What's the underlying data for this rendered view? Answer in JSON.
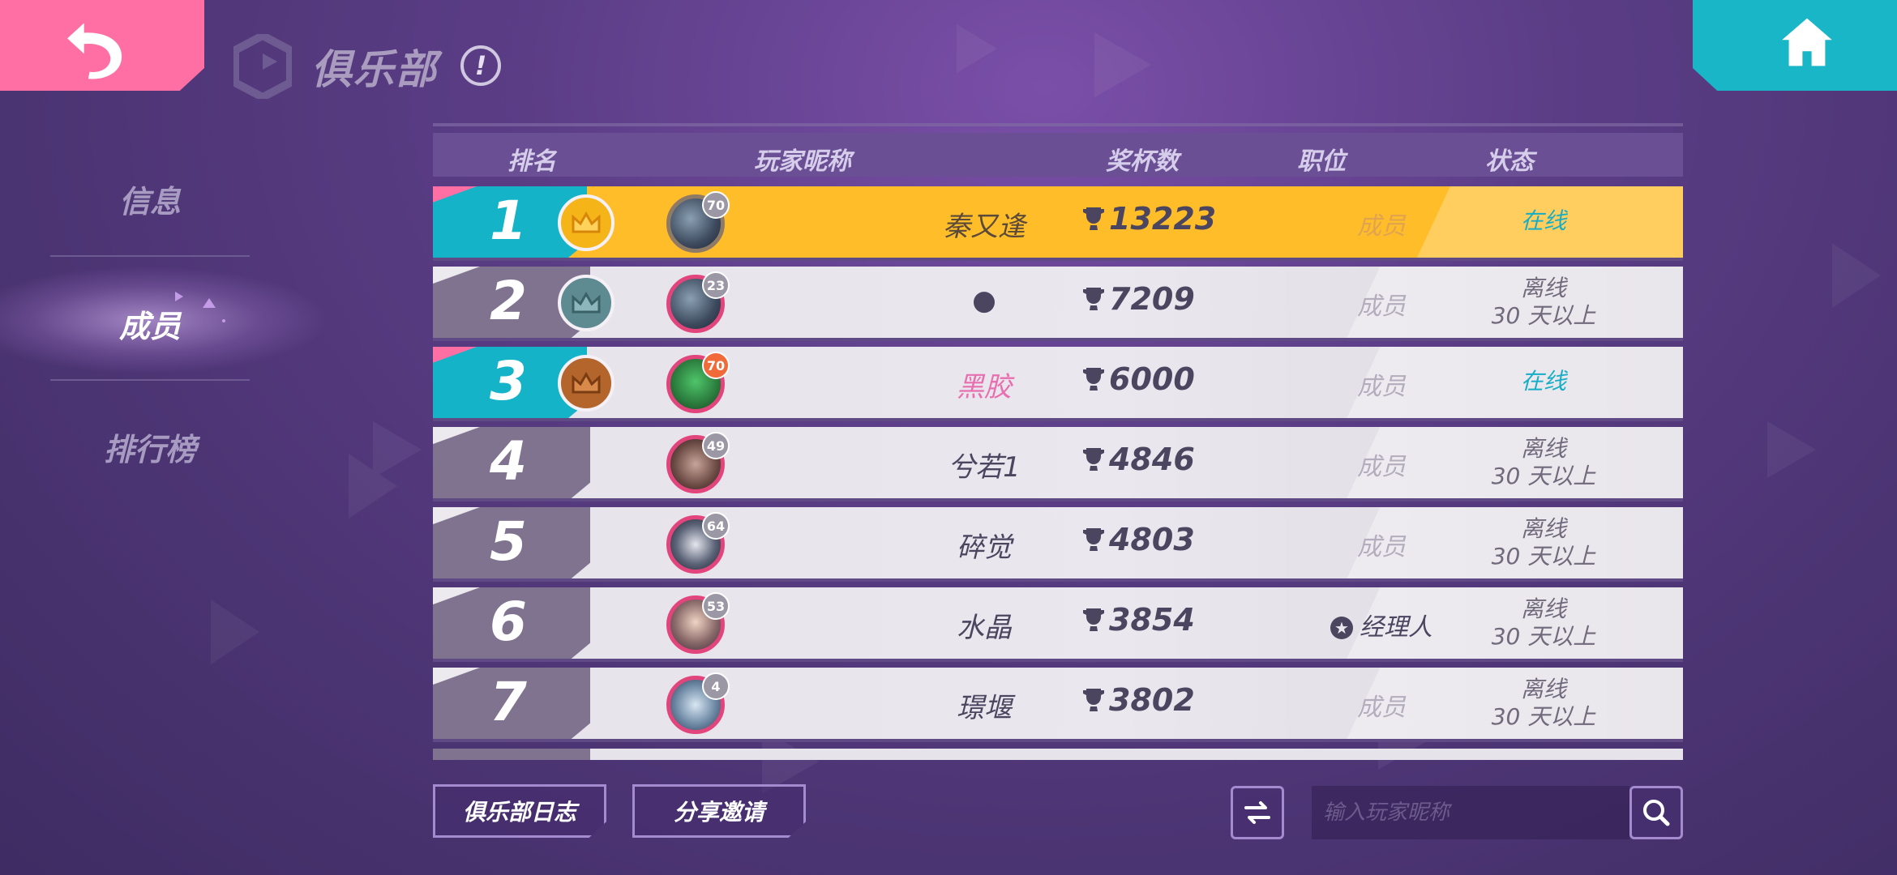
{
  "header": {
    "title": "俱乐部",
    "info_icon": "!",
    "back_icon": "back-arrow-icon",
    "home_icon": "home-icon"
  },
  "sidebar": {
    "items": [
      {
        "label": "信息"
      },
      {
        "label": "成员"
      },
      {
        "label": "排行榜"
      }
    ],
    "active": "成员"
  },
  "table": {
    "columns": [
      "排名",
      "玩家昵称",
      "奖杯数",
      "职位",
      "状态"
    ],
    "rows": [
      {
        "rank": "1",
        "level": "70",
        "name": "秦又逢",
        "trophies": "13223",
        "role": "成员",
        "status": "在线",
        "status_line2": ""
      },
      {
        "rank": "2",
        "level": "23",
        "name": "●",
        "trophies": "7209",
        "role": "成员",
        "status": "离线",
        "status_line2": "30 天以上"
      },
      {
        "rank": "3",
        "level": "70",
        "name": "黑胶",
        "trophies": "6000",
        "role": "成员",
        "status": "在线",
        "status_line2": ""
      },
      {
        "rank": "4",
        "level": "49",
        "name": "兮若1",
        "trophies": "4846",
        "role": "成员",
        "status": "离线",
        "status_line2": "30 天以上"
      },
      {
        "rank": "5",
        "level": "64",
        "name": "碎觉",
        "trophies": "4803",
        "role": "成员",
        "status": "离线",
        "status_line2": "30 天以上"
      },
      {
        "rank": "6",
        "level": "53",
        "name": "水晶",
        "trophies": "3854",
        "role": "经理人",
        "status": "离线",
        "status_line2": "30 天以上"
      },
      {
        "rank": "7",
        "level": "4",
        "name": "璟堰",
        "trophies": "3802",
        "role": "成员",
        "status": "离线",
        "status_line2": "30 天以上"
      }
    ]
  },
  "footer": {
    "club_log_label": "俱乐部日志",
    "share_invite_label": "分享邀请",
    "search_placeholder": "输入玩家昵称",
    "search_icon": "search-icon",
    "refresh_icon": "swap-icon"
  },
  "colors": {
    "gold_row": "#ffbd2a",
    "teal": "#15b3c8",
    "pink": "#ff6fa3",
    "online": "#16aec6"
  }
}
